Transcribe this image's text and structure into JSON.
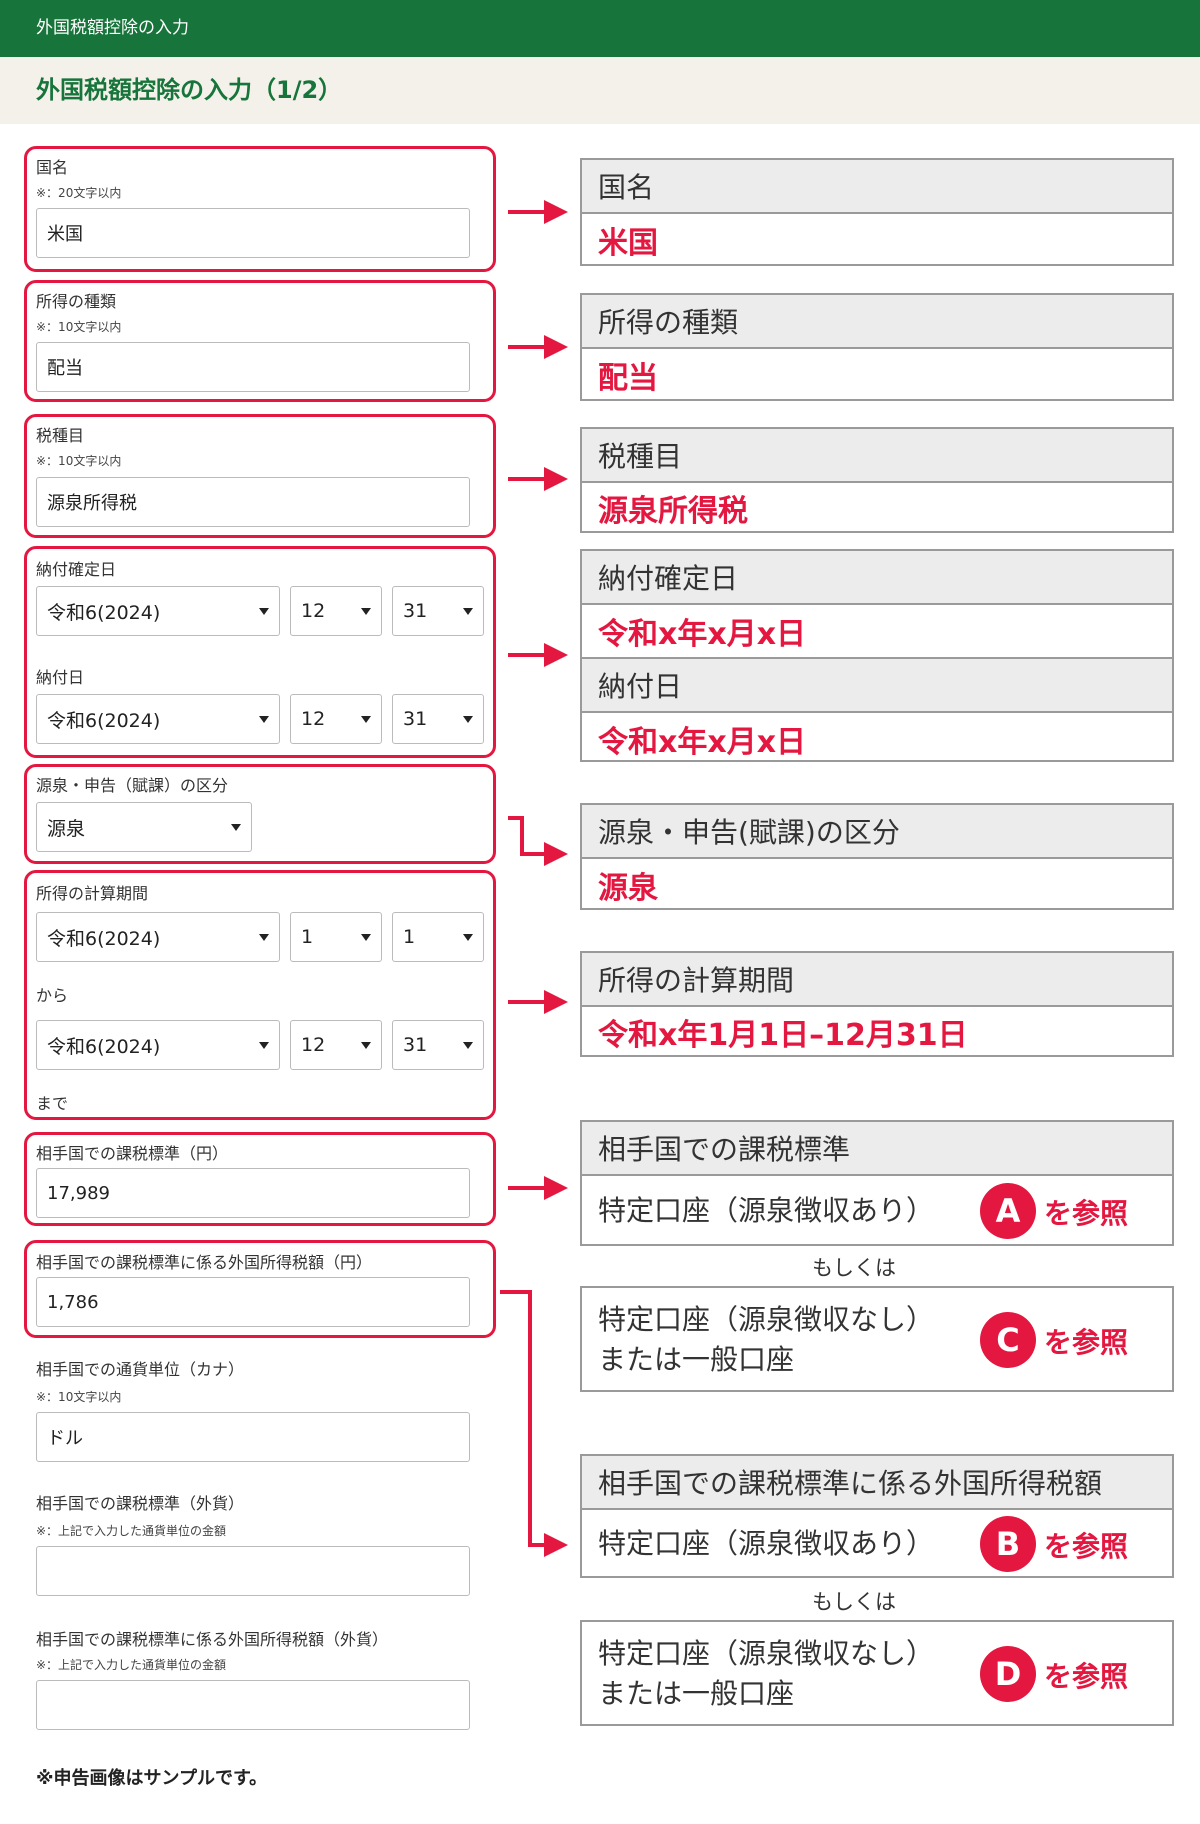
{
  "topbar": {
    "title": "外国税額控除の入力"
  },
  "page": {
    "title": "外国税額控除の入力（1/2）"
  },
  "form": {
    "country": {
      "label": "国名",
      "note": "※：20文字以内",
      "value": "米国"
    },
    "income_type": {
      "label": "所得の種類",
      "note": "※：10文字以内",
      "value": "配当"
    },
    "tax_item": {
      "label": "税種目",
      "note": "※：10文字以内",
      "value": "源泉所得税"
    },
    "pay_confirm_date": {
      "label": "納付確定日",
      "era": "令和6(2024)",
      "month": "12",
      "day": "31"
    },
    "pay_date": {
      "label": "納付日",
      "era": "令和6(2024)",
      "month": "12",
      "day": "31"
    },
    "category": {
      "label": "源泉・申告（賦課）の区分",
      "value": "源泉"
    },
    "period": {
      "label": "所得の計算期間",
      "from": {
        "era": "令和6(2024)",
        "month": "1",
        "day": "1"
      },
      "from_suffix": "から",
      "to": {
        "era": "令和6(2024)",
        "month": "12",
        "day": "31"
      },
      "to_suffix": "まで"
    },
    "tax_base_yen": {
      "label": "相手国での課税標準（円）",
      "value": "17,989"
    },
    "foreign_tax_yen": {
      "label": "相手国での課税標準に係る外国所得税額（円）",
      "value": "1,786"
    },
    "currency_unit": {
      "label": "相手国での通貨単位（カナ）",
      "note": "※：10文字以内",
      "value": "ドル"
    },
    "tax_base_fc": {
      "label": "相手国での課税標準（外貨）",
      "note": "※：上記で入力した通貨単位の金額",
      "value": ""
    },
    "foreign_tax_fc": {
      "label": "相手国での課税標準に係る外国所得税額（外貨）",
      "note": "※：上記で入力した通貨単位の金額",
      "value": ""
    }
  },
  "footnote": "※申告画像はサンプルです。",
  "explain": {
    "country": {
      "head": "国名",
      "value": "米国"
    },
    "income_type": {
      "head": "所得の種類",
      "value": "配当"
    },
    "tax_item": {
      "head": "税種目",
      "value": "源泉所得税"
    },
    "dates": {
      "head1": "納付確定日",
      "value1": "令和x年x月x日",
      "head2": "納付日",
      "value2": "令和x年x月x日"
    },
    "category": {
      "head": "源泉・申告(賦課)の区分",
      "value": "源泉"
    },
    "period": {
      "head": "所得の計算期間",
      "value": "令和x年1月1日–12月31日"
    },
    "tax_base": {
      "head": "相手国での課税標準",
      "line1": "特定口座（源泉徴収あり）",
      "badge": "A",
      "ref": "を参照"
    },
    "tax_base_alt": {
      "line1": "特定口座（源泉徴収なし）",
      "line2": "または一般口座",
      "badge": "C",
      "ref": "を参照"
    },
    "foreign_tax": {
      "head": "相手国での課税標準に係る外国所得税額",
      "line1": "特定口座（源泉徴収あり）",
      "badge": "B",
      "ref": "を参照"
    },
    "foreign_tax_alt": {
      "line1": "特定口座（源泉徴収なし）",
      "line2": "または一般口座",
      "badge": "D",
      "ref": "を参照"
    },
    "or_label": "もしくは"
  },
  "colors": {
    "header_green": "#17743a",
    "title_bg": "#f4f1ea",
    "accent_red": "#e3173f",
    "box_gray": "#ececec"
  }
}
